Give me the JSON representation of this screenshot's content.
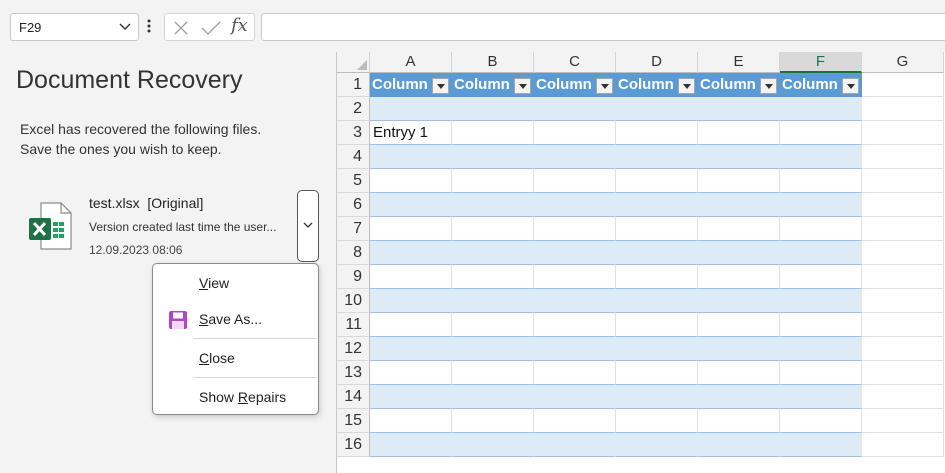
{
  "formula_bar": {
    "name_box": "F29",
    "formula": ""
  },
  "recovery": {
    "title": "Document Recovery",
    "description_line1": "Excel has recovered the following files.",
    "description_line2": "Save the ones you wish to keep.",
    "file": {
      "name": "test.xlsx  [Original]",
      "description": "Version created last time the user...",
      "date": "12.09.2023 08:06"
    },
    "menu": {
      "view_accel": "V",
      "view_rest": "iew",
      "save_accel": "S",
      "save_rest": "ave As...",
      "close_accel": "C",
      "close_rest": "lose",
      "repairs_pre": "Show ",
      "repairs_accel": "R",
      "repairs_rest": "epairs"
    }
  },
  "sheet": {
    "columns": [
      "A",
      "B",
      "C",
      "D",
      "E",
      "F",
      "G"
    ],
    "selected_column": "F",
    "rows": [
      "1",
      "2",
      "3",
      "4",
      "5",
      "6",
      "7",
      "8",
      "9",
      "10",
      "11",
      "12",
      "13",
      "14",
      "15",
      "16"
    ],
    "table_headers": [
      "Column",
      "Column",
      "Column",
      "Column",
      "Column",
      "Column"
    ],
    "a3": "Entryy 1"
  },
  "colors": {
    "table_header": "#5b9bd5",
    "table_band": "#ddebf7",
    "excel_green": "#1e7145"
  }
}
